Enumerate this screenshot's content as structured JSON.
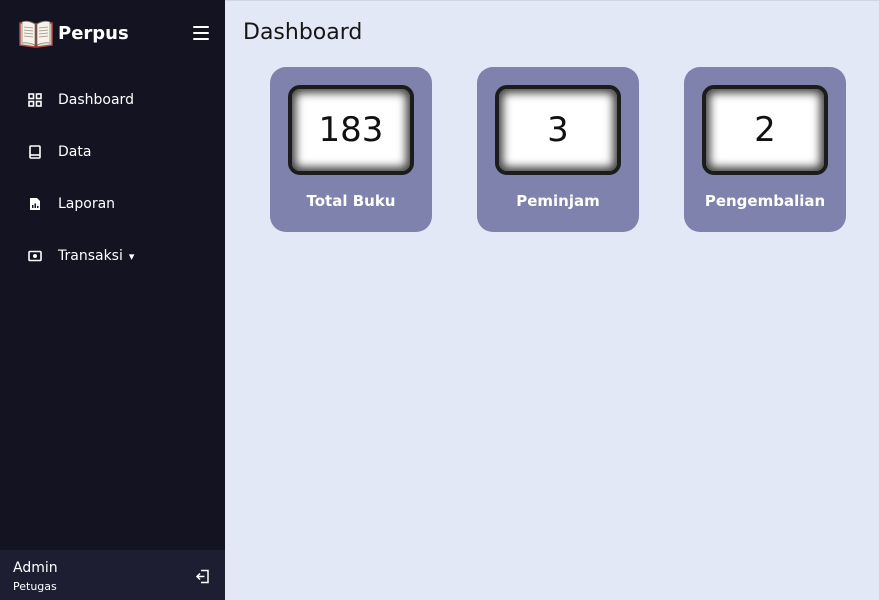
{
  "app": {
    "name": "Perpus",
    "logo_icon": "open-book-icon"
  },
  "colors": {
    "sidebar_bg": "#131321",
    "footer_bg": "#1e1e33",
    "main_bg": "#e3e8f6",
    "card_bg": "#7e82ac"
  },
  "sidebar": {
    "items": [
      {
        "label": "Dashboard",
        "icon": "grid-icon"
      },
      {
        "label": "Data",
        "icon": "book-icon"
      },
      {
        "label": "Laporan",
        "icon": "report-file-icon"
      },
      {
        "label": "Transaksi",
        "icon": "cash-icon",
        "caret": "▾"
      }
    ],
    "user": {
      "name": "Admin",
      "role": "Petugas"
    }
  },
  "main": {
    "title": "Dashboard",
    "cards": [
      {
        "value": "183",
        "label": "Total Buku"
      },
      {
        "value": "3",
        "label": "Peminjam"
      },
      {
        "value": "2",
        "label": "Pengembalian"
      }
    ]
  }
}
